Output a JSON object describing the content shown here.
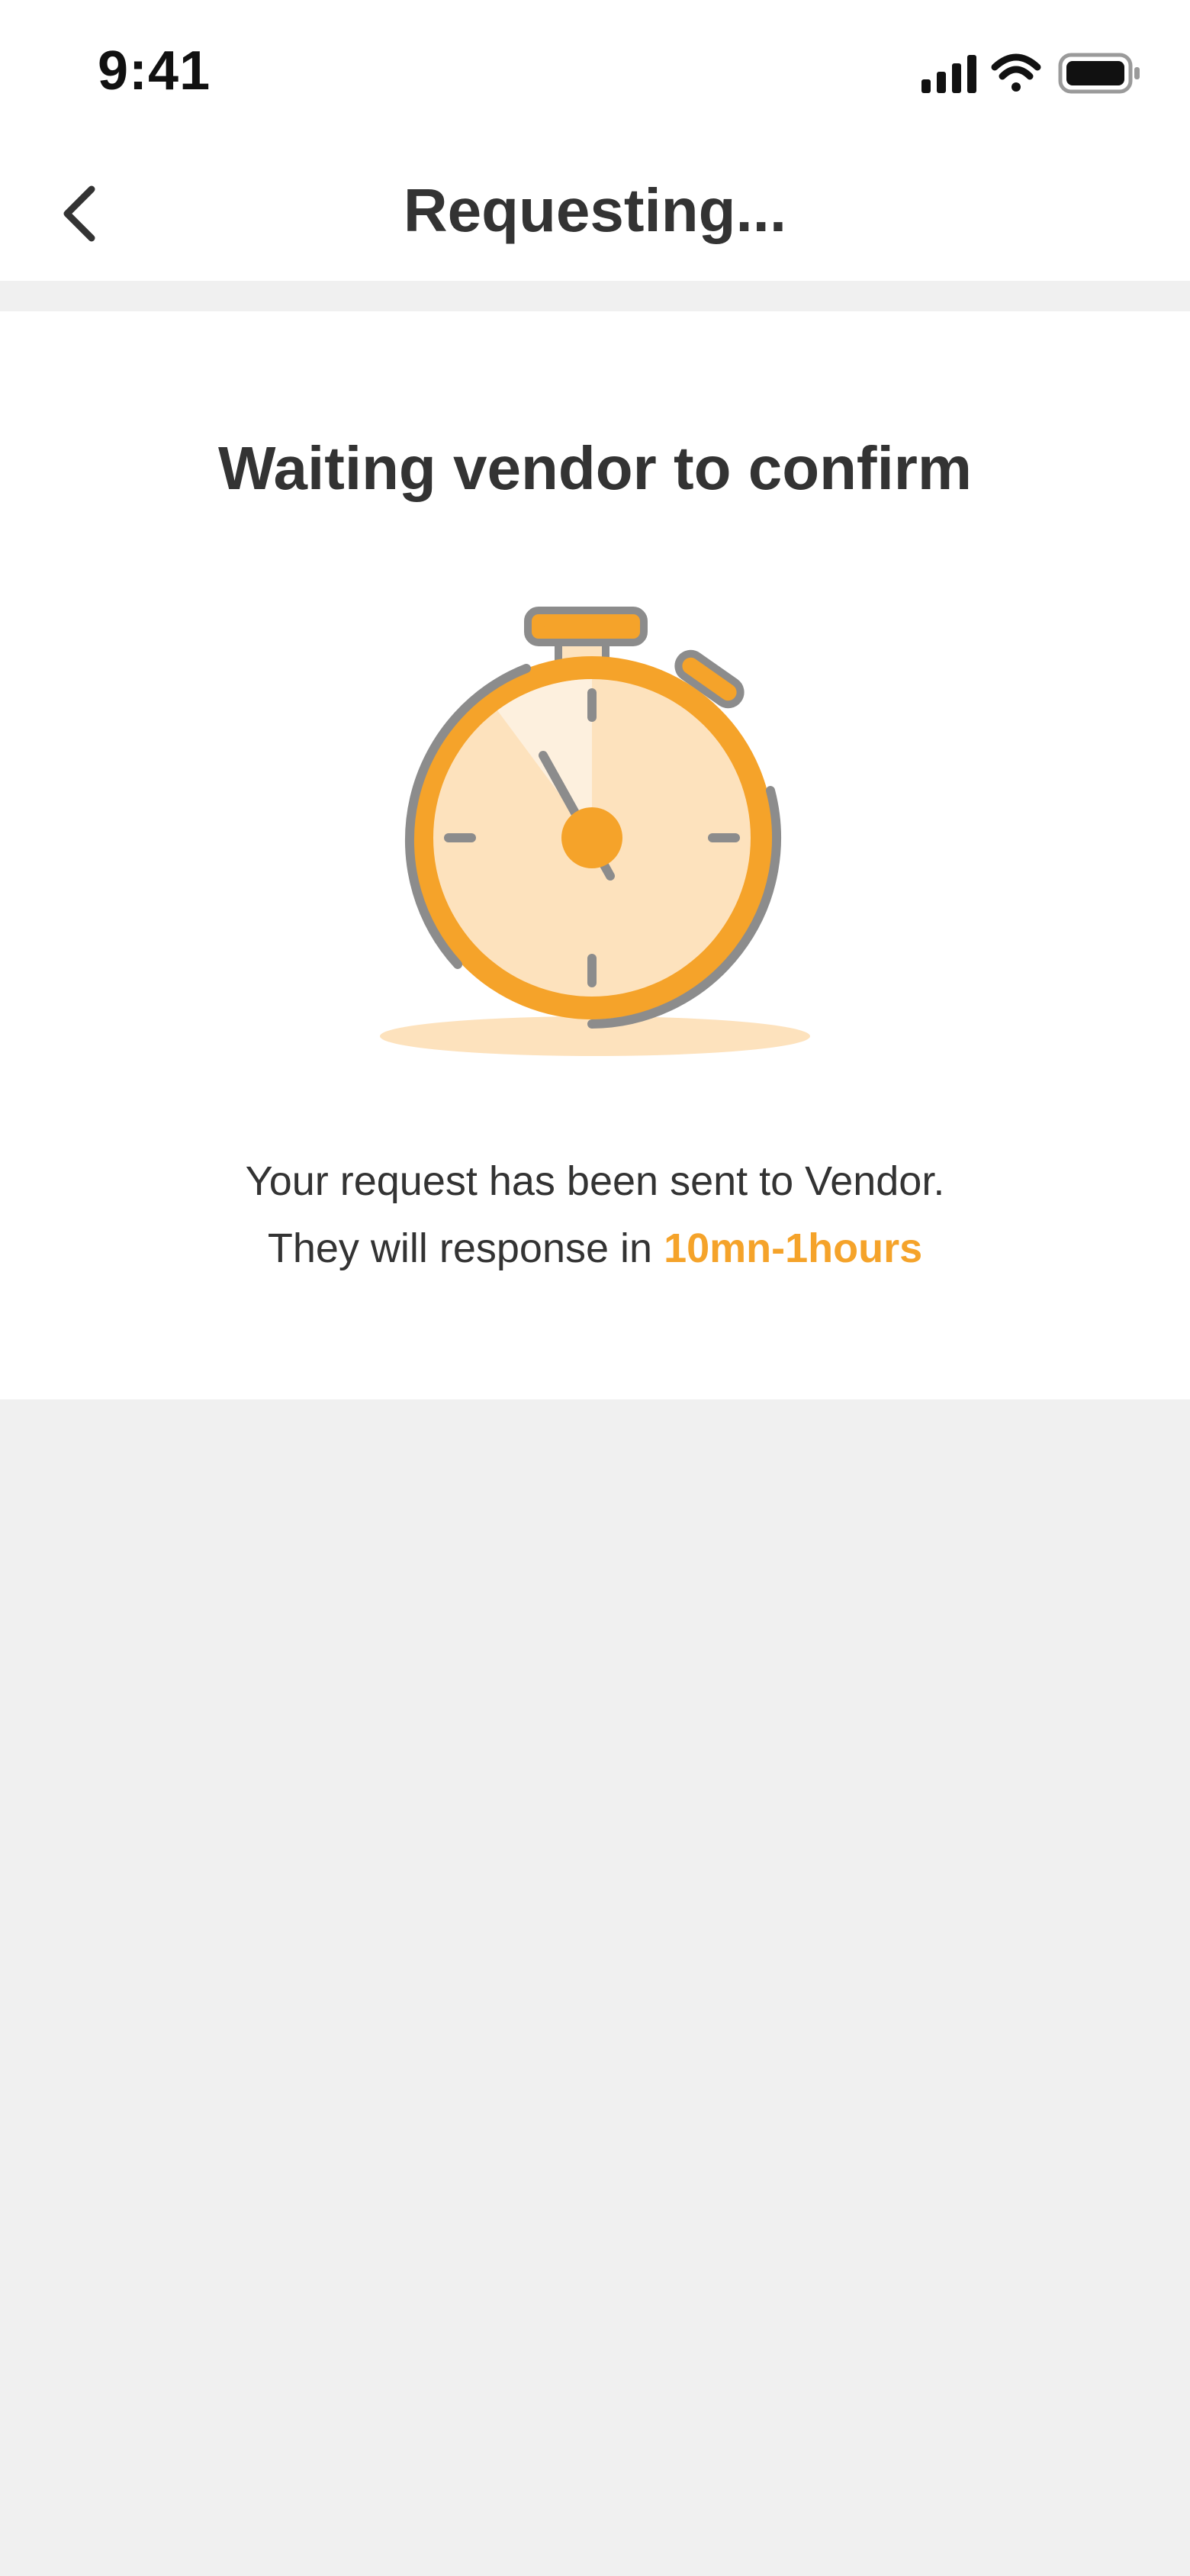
{
  "status_bar": {
    "time": "9:41",
    "signal_icon": "cellular-signal-icon",
    "wifi_icon": "wifi-icon",
    "battery_icon": "battery-icon"
  },
  "nav": {
    "back_icon": "chevron-left-icon",
    "title": "Requesting..."
  },
  "card": {
    "title": "Waiting vendor to confirm",
    "illustration_icon": "stopwatch-icon",
    "message_line1": "Your request has been sent to Vendor.",
    "message_line2_prefix": "They will response in ",
    "message_line2_highlight": "10mn-1hours"
  },
  "colors": {
    "accent": "#f5a32a",
    "accent_light": "#fde2bd",
    "outline": "#8c8c8c",
    "background": "#f0f0f0",
    "text": "#333333"
  }
}
